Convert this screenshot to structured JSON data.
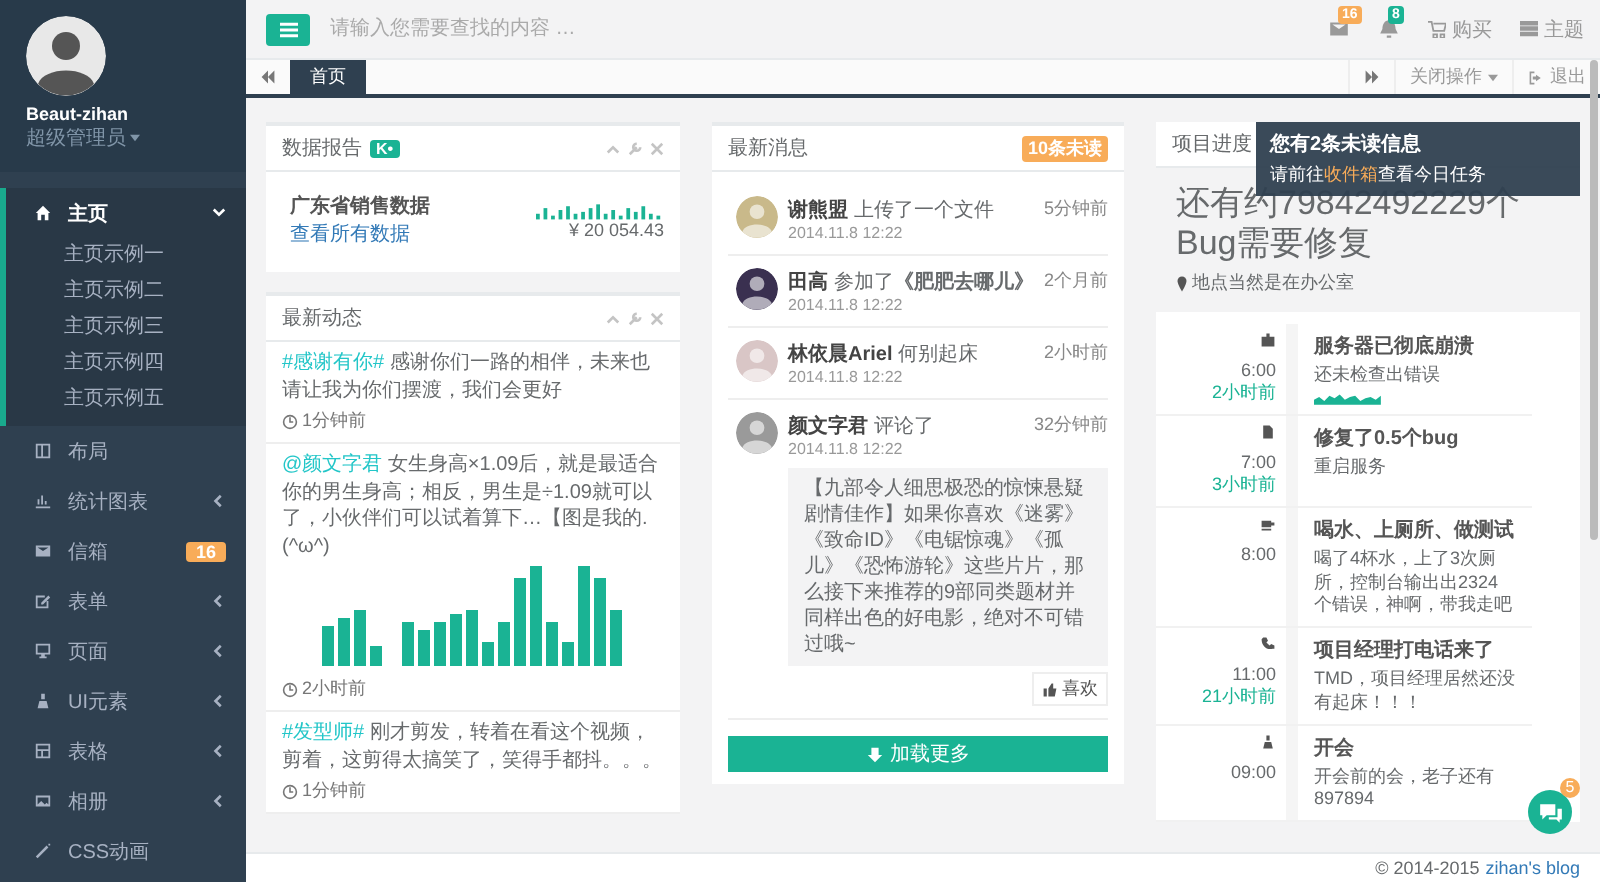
{
  "sidebar": {
    "profile": {
      "name": "Beaut-zihan",
      "role": "超级管理员"
    },
    "menu": [
      {
        "label": "主页",
        "kind": "group",
        "expanded": true,
        "selected": true,
        "children": [
          {
            "label": "主页示例一"
          },
          {
            "label": "主页示例二"
          },
          {
            "label": "主页示例三"
          },
          {
            "label": "主页示例四"
          },
          {
            "label": "主页示例五"
          }
        ]
      },
      {
        "label": "布局",
        "kind": "link",
        "selected": false
      },
      {
        "label": "统计图表",
        "kind": "group",
        "expanded": false,
        "selected": false
      },
      {
        "label": "信箱",
        "kind": "link",
        "selected": false,
        "badge": "16"
      },
      {
        "label": "表单",
        "kind": "group",
        "expanded": false,
        "selected": false
      },
      {
        "label": "页面",
        "kind": "group",
        "expanded": false,
        "selected": false
      },
      {
        "label": "UI元素",
        "kind": "group",
        "expanded": false,
        "selected": false
      },
      {
        "label": "表格",
        "kind": "group",
        "expanded": false,
        "selected": false
      },
      {
        "label": "相册",
        "kind": "group",
        "expanded": false,
        "selected": false
      },
      {
        "label": "CSS动画",
        "kind": "link",
        "selected": false
      }
    ]
  },
  "header": {
    "search": {
      "placeholder": "请输入您需要查找的内容 …"
    },
    "notifications": [
      {
        "badge": "16",
        "color": "#f8ac59"
      },
      {
        "badge": "8",
        "color": "#1ab394"
      }
    ],
    "links": [
      "购买",
      "主题"
    ]
  },
  "tabs_bar": {
    "tabs": [
      {
        "label": "首页",
        "selected": true
      }
    ],
    "close_menu": "关闭操作",
    "logout": "退出"
  },
  "data_report": {
    "title": "数据报告",
    "badge": "K•",
    "heading": "广东省销售数据",
    "link": "查看所有数据",
    "amount": "¥ 20 054.43"
  },
  "feed": {
    "title": "最新动态",
    "entries": [
      {
        "tag": "#感谢有你#",
        "text": " 感谢你们一路的相伴，未来也请让我为你们摆渡，我们会更好",
        "time": "1分钟前"
      },
      {
        "tag": "@颜文字君",
        "text": " 女生身高×1.09后，就是最适合你的男生身高；相反，男生是÷1.09就可以了，小伙伴们可以试着算下…【图是我的. (^ω^)",
        "time": "2小时前",
        "chart": true
      },
      {
        "tag": "#发型师#",
        "text": " 刚才剪发，转着在看这个视频，剪着，这剪得太搞笑了，笑得手都抖。。。",
        "time": "1分钟前"
      }
    ]
  },
  "messages": {
    "title": "最新消息",
    "badge": "10条未读",
    "items": [
      {
        "name": "谢熊盟",
        "action": "上传了一个文件",
        "ago": "5分钟前",
        "date": "2014.11.8 12:22"
      },
      {
        "name": "田高",
        "action": "参加了**《肥肥去哪儿》**",
        "ago": "2个月前",
        "date": "2014.11.8 12:22"
      },
      {
        "name": "林依晨Ariel",
        "action": "何别起床",
        "ago": "2小时前",
        "date": "2014.11.8 12:22"
      },
      {
        "name": "颜文字君",
        "action": "评论了",
        "ago": "32分钟前",
        "date": "2014.11.8 12:22",
        "quote": "【九部令人细思极恐的惊悚悬疑剧情佳作】如果你喜欢《迷雾》《致命ID》《电锯惊魂》《孤儿》《恐怖游轮》这些片片，那么接下来推荐的9部同类题材并同样出色的好电影，绝对不可错过哦~",
        "like": "喜欢"
      }
    ],
    "load_more": "加载更多"
  },
  "progress": {
    "title": "项目进度",
    "headline": "还有约79842492229个Bug需要修复",
    "location": "地点当然是在办公室",
    "timeline": [
      {
        "time": "6:00",
        "ago": "2小时前",
        "title": "服务器已彻底崩溃",
        "text": "还未检查出错误",
        "chart": true
      },
      {
        "time": "7:00",
        "ago": "3小时前",
        "title": "修复了0.5个bug",
        "text": "重启服务"
      },
      {
        "time": "8:00",
        "title": "喝水、上厕所、做测试",
        "text": "喝了4杯水，上了3次厕所，控制台输出出2324个错误，神啊，带我走吧"
      },
      {
        "time": "11:00",
        "ago": "21小时前",
        "title": "项目经理打电话来了",
        "text": "TMD，项目经理居然还没有起床！！！"
      },
      {
        "time": "09:00",
        "title": "开会",
        "text": "开会前的会，老子还有897894"
      }
    ]
  },
  "toast": {
    "title": "您有2条未读信息",
    "before": "请前往",
    "link": "收件箱",
    "after": "查看今日任务"
  },
  "chat": {
    "badge": "5"
  },
  "footer": {
    "copyright": "© 2014-2015",
    "link": "zihan's blog"
  }
}
